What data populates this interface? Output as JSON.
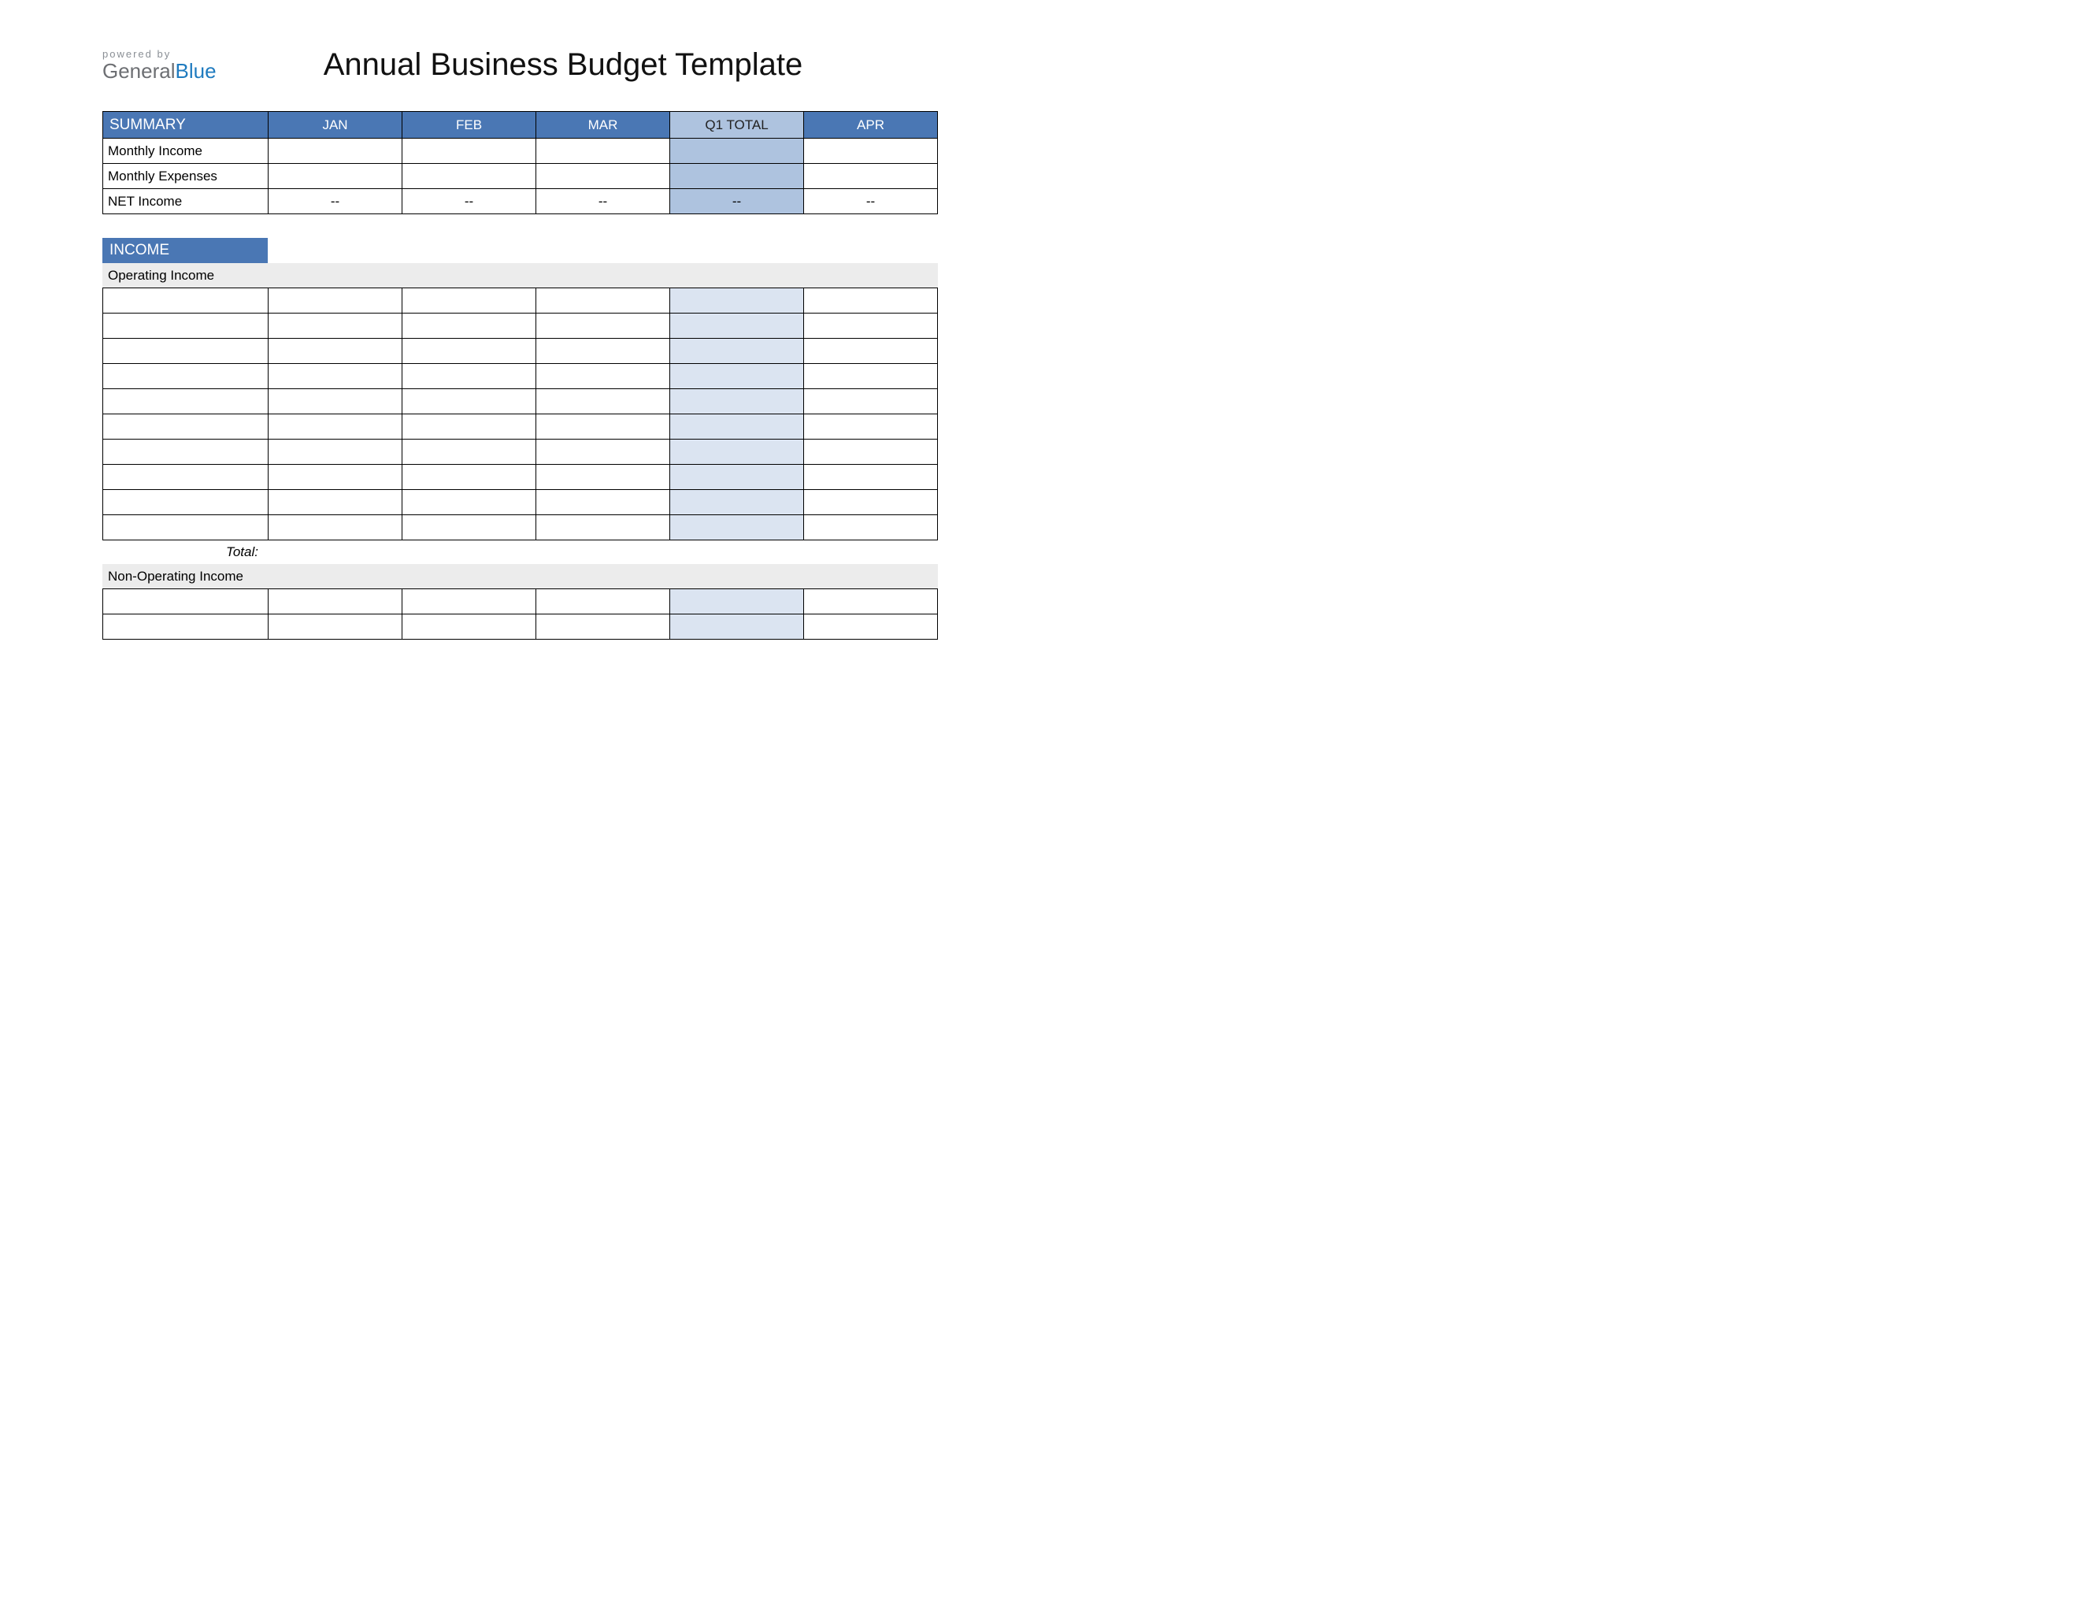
{
  "branding": {
    "powered_by": "powered by",
    "logo_part1": "General",
    "logo_part2": "Blue"
  },
  "title": "Annual Business Budget Template",
  "columns": {
    "summary": "SUMMARY",
    "jan": "JAN",
    "feb": "FEB",
    "mar": "MAR",
    "q1": "Q1 TOTAL",
    "apr": "APR"
  },
  "summary_rows": [
    {
      "label": "Monthly Income",
      "jan": "",
      "feb": "",
      "mar": "",
      "q1": "",
      "apr": ""
    },
    {
      "label": "Monthly Expenses",
      "jan": "",
      "feb": "",
      "mar": "",
      "q1": "",
      "apr": ""
    },
    {
      "label": "NET Income",
      "jan": "--",
      "feb": "--",
      "mar": "--",
      "q1": "--",
      "apr": "--"
    }
  ],
  "income": {
    "section_title": "INCOME",
    "operating": {
      "label": "Operating Income",
      "rows": 10,
      "total_label": "Total:"
    },
    "non_operating": {
      "label": "Non-Operating Income",
      "rows": 2
    }
  }
}
